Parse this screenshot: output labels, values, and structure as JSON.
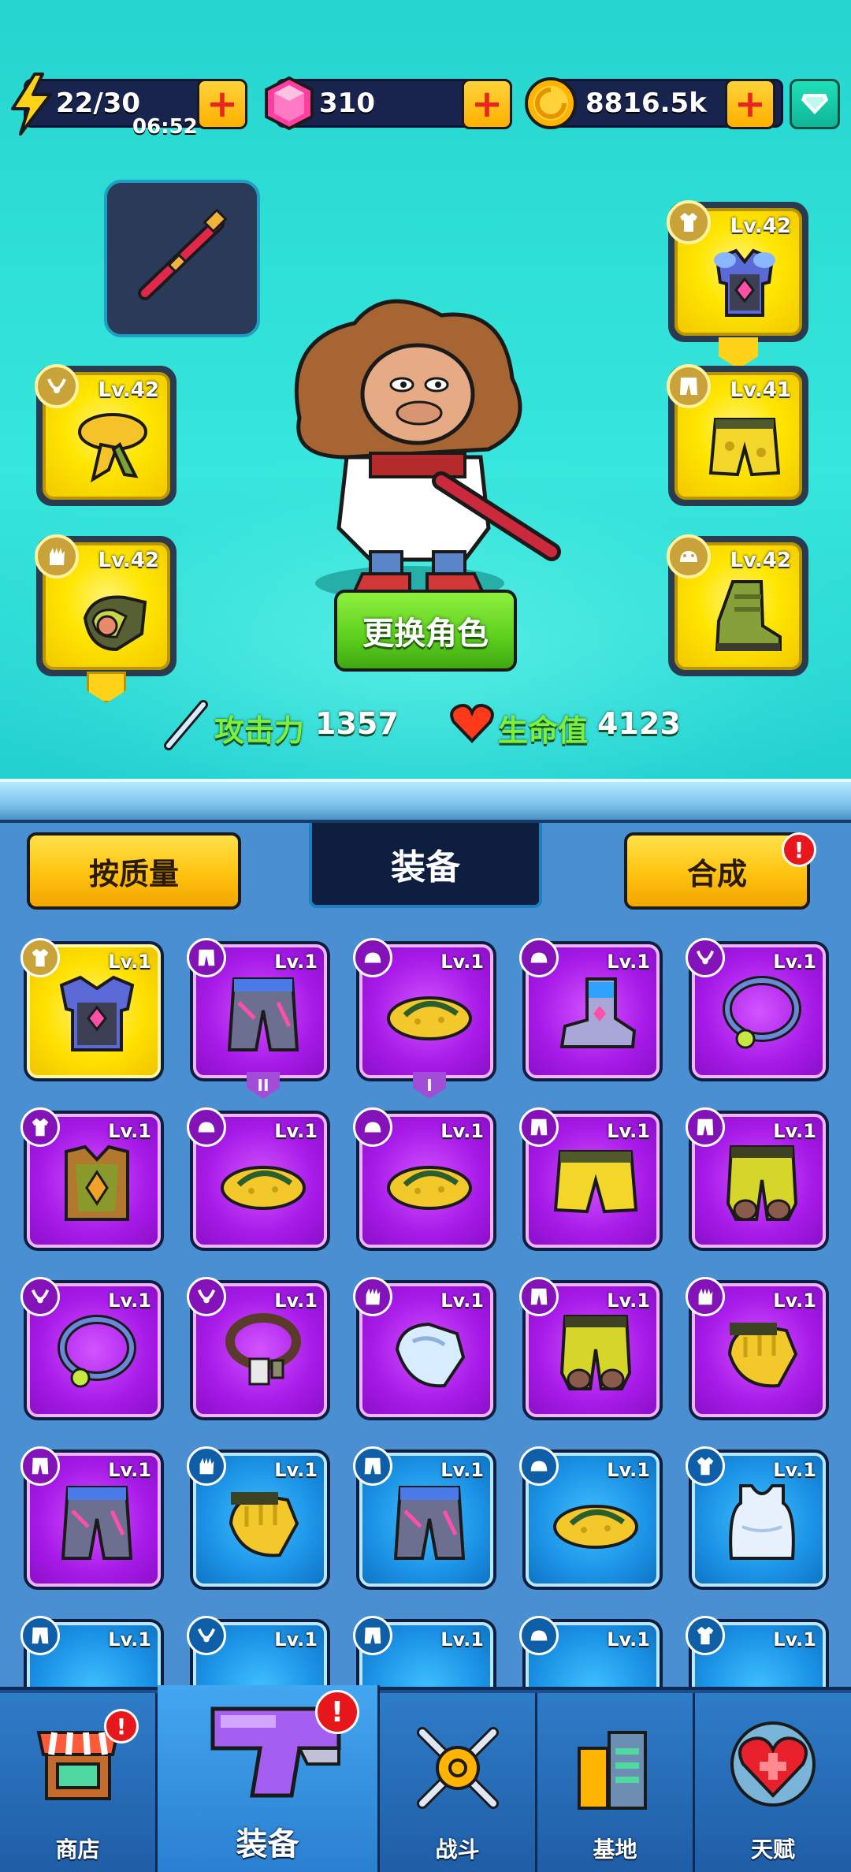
{
  "resources": {
    "energy": {
      "value": "22/30",
      "timer": "06:52"
    },
    "gems": {
      "value": "310"
    },
    "coins": {
      "value": "8816.5k"
    }
  },
  "hero": {
    "change_button": "更换角色",
    "attack_label": "攻击力",
    "attack_value": "1357",
    "hp_label": "生命值",
    "hp_value": "4123",
    "equipped": [
      {
        "slot": "necklace",
        "level": "Lv.42"
      },
      {
        "slot": "gloves",
        "level": "Lv.42"
      },
      {
        "slot": "armor",
        "level": "Lv.42"
      },
      {
        "slot": "pants",
        "level": "Lv.41"
      },
      {
        "slot": "boots",
        "level": "Lv.42"
      }
    ]
  },
  "inventory": {
    "sort_button": "按质量",
    "tab_title": "装备",
    "merge_button": "合成",
    "alert_mark": "!",
    "items": [
      {
        "rarity": "yellow",
        "type": "armor",
        "level": "Lv.1",
        "art": "armor"
      },
      {
        "rarity": "purple",
        "type": "pants",
        "level": "Lv.1",
        "art": "pants-armor",
        "rank": "II"
      },
      {
        "rarity": "purple",
        "type": "boots",
        "level": "Lv.1",
        "art": "sandal",
        "rank": "I"
      },
      {
        "rarity": "purple",
        "type": "boots",
        "level": "Lv.1",
        "art": "boot-tech"
      },
      {
        "rarity": "purple",
        "type": "necklace",
        "level": "Lv.1",
        "art": "necklace"
      },
      {
        "rarity": "purple",
        "type": "armor",
        "level": "Lv.1",
        "art": "vest"
      },
      {
        "rarity": "purple",
        "type": "boots",
        "level": "Lv.1",
        "art": "sandal"
      },
      {
        "rarity": "purple",
        "type": "boots",
        "level": "Lv.1",
        "art": "sandal"
      },
      {
        "rarity": "purple",
        "type": "pants",
        "level": "Lv.1",
        "art": "shorts"
      },
      {
        "rarity": "purple",
        "type": "pants",
        "level": "Lv.1",
        "art": "camo-pants"
      },
      {
        "rarity": "purple",
        "type": "necklace",
        "level": "Lv.1",
        "art": "necklace"
      },
      {
        "rarity": "purple",
        "type": "necklace",
        "level": "Lv.1",
        "art": "tag-necklace"
      },
      {
        "rarity": "purple",
        "type": "gloves",
        "level": "Lv.1",
        "art": "glove-white"
      },
      {
        "rarity": "purple",
        "type": "pants",
        "level": "Lv.1",
        "art": "camo-pants"
      },
      {
        "rarity": "purple",
        "type": "gloves",
        "level": "Lv.1",
        "art": "glove-yellow"
      },
      {
        "rarity": "purple",
        "type": "pants",
        "level": "Lv.1",
        "art": "pants-armor"
      },
      {
        "rarity": "blue",
        "type": "gloves",
        "level": "Lv.1",
        "art": "glove-yellow"
      },
      {
        "rarity": "blue",
        "type": "pants",
        "level": "Lv.1",
        "art": "pants-armor"
      },
      {
        "rarity": "blue",
        "type": "boots",
        "level": "Lv.1",
        "art": "sandal"
      },
      {
        "rarity": "blue",
        "type": "armor",
        "level": "Lv.1",
        "art": "tank-top"
      },
      {
        "rarity": "blue",
        "type": "pants",
        "level": "Lv.1",
        "art": "none"
      },
      {
        "rarity": "blue",
        "type": "necklace",
        "level": "Lv.1",
        "art": "none"
      },
      {
        "rarity": "blue",
        "type": "pants",
        "level": "Lv.1",
        "art": "none"
      },
      {
        "rarity": "blue",
        "type": "boots",
        "level": "Lv.1",
        "art": "none"
      },
      {
        "rarity": "blue",
        "type": "armor",
        "level": "Lv.1",
        "art": "none"
      }
    ]
  },
  "nav": {
    "shop": "商店",
    "equipment": "装备",
    "battle": "战斗",
    "base": "基地",
    "talent": "天赋",
    "alert_mark": "!"
  },
  "colors": {
    "accent_yellow": "#ffc20f",
    "accent_green": "#5ccf1e",
    "rarity_purple": "#a71ae8",
    "rarity_blue": "#1c93e6",
    "alert_red": "#e8171b"
  }
}
